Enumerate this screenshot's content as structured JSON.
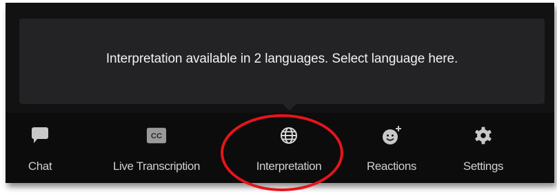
{
  "tooltip": {
    "message": "Interpretation available in 2 languages. Select language here."
  },
  "toolbar": {
    "chat_label": "Chat",
    "live_transcription_label": "Live Transcription",
    "live_transcription_icon_text": "CC",
    "interpretation_label": "Interpretation",
    "reactions_label": "Reactions",
    "settings_label": "Settings"
  },
  "icons": {
    "chat": "chat-bubble-icon",
    "live_transcription": "closed-caption-icon",
    "interpretation": "globe-icon",
    "reactions": "emoji-add-icon",
    "settings": "gear-icon"
  },
  "colors": {
    "toolbar_bg": "#0c0c0c",
    "tooltip_bg": "#232325",
    "icon": "#c8c8c8",
    "highlight_ring": "#e8141b"
  }
}
